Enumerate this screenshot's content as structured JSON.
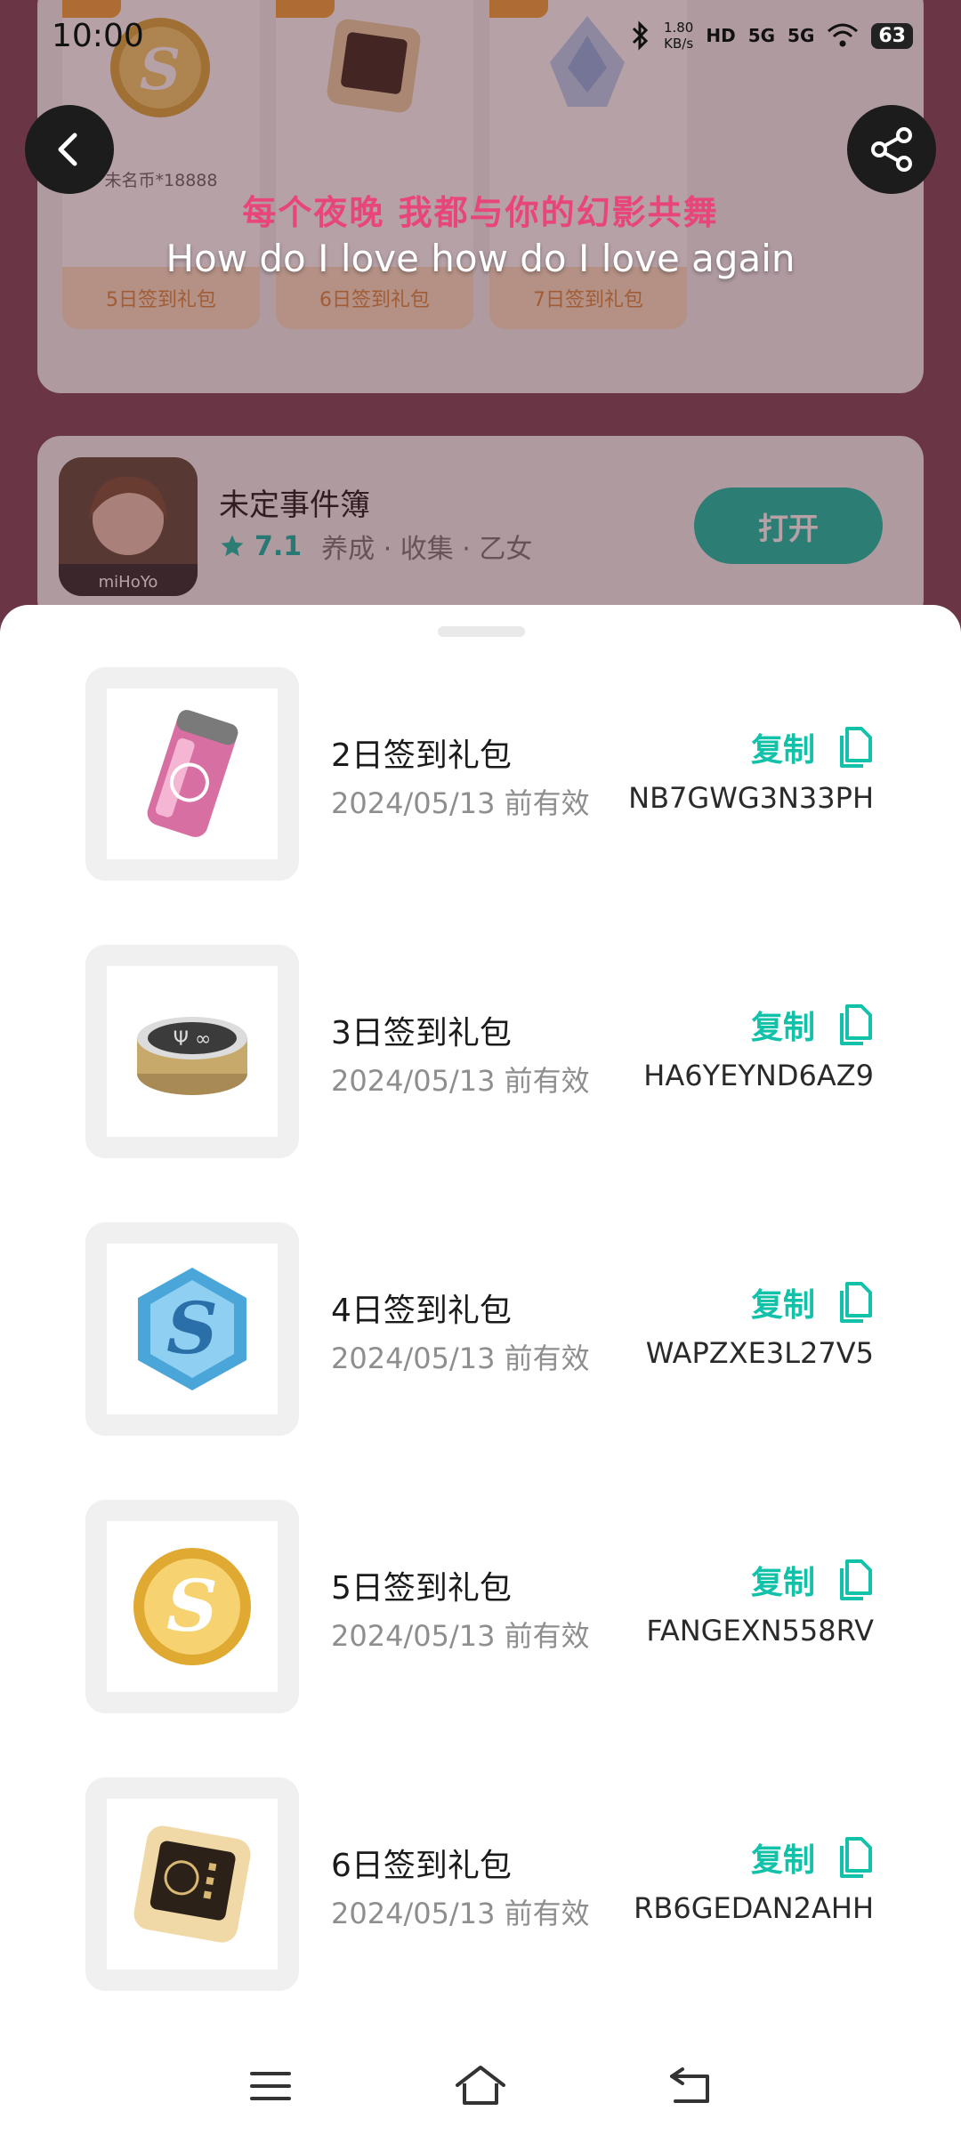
{
  "status_bar": {
    "time": "10:00",
    "net_speed_value": "1.80",
    "net_speed_unit": "KB/s",
    "hd_label": "HD",
    "signal1_label": "5G",
    "signal2_label": "5G",
    "battery": "63"
  },
  "lyrics": {
    "line1": "每个夜晚 我都与你的幻影共舞",
    "line2": "How do I love how do I love again"
  },
  "background": {
    "signin_cards": [
      {
        "sub": "未名币*18888",
        "label": "5日签到礼包"
      },
      {
        "sub": "",
        "label": "6日签到礼包"
      },
      {
        "sub": "",
        "label": "7日签到礼包"
      }
    ],
    "app": {
      "name": "未定事件簿",
      "score": "7.1",
      "tags": "养成 · 收集 · 乙女",
      "open_label": "打开",
      "icon_brand": "miHoYo"
    }
  },
  "gifts": [
    {
      "name": "2日签到礼包",
      "expiry": "2024/05/13 前有效",
      "code": "NB7GWG3N33PH",
      "copy_label": "复制",
      "item_icon": "pink-canister-icon"
    },
    {
      "name": "3日签到礼包",
      "expiry": "2024/05/13 前有效",
      "code": "HA6YEYND6AZ9",
      "copy_label": "复制",
      "item_icon": "tin-can-icon"
    },
    {
      "name": "4日签到礼包",
      "expiry": "2024/05/13 前有效",
      "code": "WAPZXE3L27V5",
      "copy_label": "复制",
      "item_icon": "blue-hexagon-coin-icon"
    },
    {
      "name": "5日签到礼包",
      "expiry": "2024/05/13 前有效",
      "code": "FANGEXN558RV",
      "copy_label": "复制",
      "item_icon": "gold-coin-icon"
    },
    {
      "name": "6日签到礼包",
      "expiry": "2024/05/13 前有效",
      "code": "RB6GEDAN2AHH",
      "copy_label": "复制",
      "item_icon": "gold-chip-icon"
    }
  ],
  "colors": {
    "accent": "#12c2a8",
    "lyric_highlight": "#e8457a",
    "background_tint": "#7c4556"
  }
}
